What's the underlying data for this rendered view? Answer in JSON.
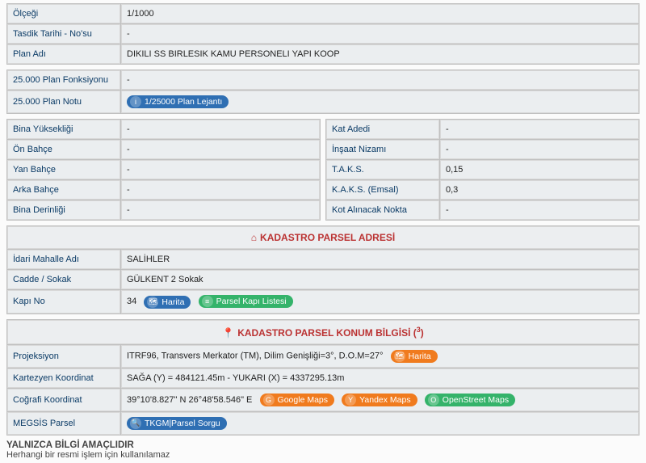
{
  "plan": {
    "olcegi_label": "Ölçeği",
    "olcegi": "1/1000",
    "tasdik_label": "Tasdik Tarihi - No'su",
    "tasdik": "-",
    "planadi_label": "Plan Adı",
    "planadi": "DIKILI SS BIRLESIK KAMU PERSONELI YAPI KOOP"
  },
  "plan25": {
    "fonksiyon_label": "25.000 Plan Fonksiyonu",
    "fonksiyon": "-",
    "notu_label": "25.000 Plan Notu",
    "lejant_btn": "1/25000 Plan Lejantı"
  },
  "dims_left": {
    "binayuk_label": "Bina Yüksekliği",
    "binayuk": "-",
    "onbahce_label": "Ön Bahçe",
    "onbahce": "-",
    "yanbahce_label": "Yan Bahçe",
    "yanbahce": "-",
    "arkabahce_label": "Arka Bahçe",
    "arkabahce": "-",
    "binader_label": "Bina Derinliği",
    "binader": "-"
  },
  "dims_right": {
    "katadedi_label": "Kat Adedi",
    "katadedi": "-",
    "insaat_label": "İnşaat Nizamı",
    "insaat": "-",
    "taks_label": "T.A.K.S.",
    "taks": "0,15",
    "kaks_label": "K.A.K.S. (Emsal)",
    "kaks": "0,3",
    "kot_label": "Kot Alınacak Nokta",
    "kot": "-"
  },
  "adres": {
    "header": "KADASTRO PARSEL ADRESİ",
    "mahalle_label": "İdari Mahalle Adı",
    "mahalle": "SALİHLER",
    "cadde_label": "Cadde / Sokak",
    "cadde": "GÜLKENT 2 Sokak",
    "kapino_label": "Kapı No",
    "kapino": "34",
    "harita_btn": "Harita",
    "parsel_kapi_btn": "Parsel Kapı Listesi"
  },
  "konum": {
    "header": "KADASTRO PARSEL KONUM BİLGİSİ (",
    "header_sup": "3",
    "header_close": ")",
    "proj_label": "Projeksiyon",
    "proj": "ITRF96, Transvers Merkator (TM), Dilim Genişliği=3°, D.O.M=27°",
    "proj_harita_btn": "Harita",
    "kart_label": "Kartezyen Koordinat",
    "kart": "SAĞA (Y) = 484121.45m - YUKARI (X) = 4337295.13m",
    "cog_label": "Coğrafi Koordinat",
    "cog": "39°10'8.827\" N 26°48'58.546\" E",
    "gmaps_btn": "Google Maps",
    "ymaps_btn": "Yandex Maps",
    "osm_btn": "OpenStreet Maps",
    "megsis_label": "MEGSİS Parsel",
    "megsis_btn": "TKGM|Parsel Sorgu"
  },
  "footer": {
    "title": "YALNIZCA BİLGİ AMAÇLIDIR",
    "sub": "Herhangi bir resmi işlem için kullanılamaz"
  }
}
